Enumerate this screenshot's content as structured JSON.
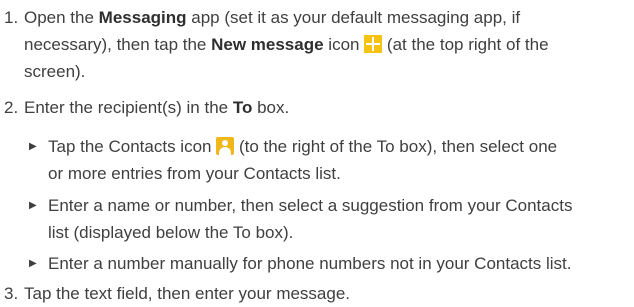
{
  "steps": [
    {
      "number": "1.",
      "a": "Open the ",
      "app_name": "Messaging",
      "b": " app (set it as your default messaging app, if",
      "c": "necessary), then tap the ",
      "icon_label": "New message",
      "d": " icon ",
      "e": " (at the top right of the",
      "f": "screen).",
      "icon": "new-message-plus-icon",
      "icon_color": "#f6c312"
    },
    {
      "number": "2.",
      "a": "Enter the recipient(s) in the ",
      "field": "To",
      "b": " box."
    },
    {
      "number": "3.",
      "text": "Tap the text field, then enter your message."
    }
  ],
  "substeps": [
    {
      "a": "Tap the Contacts icon ",
      "b": " (to the right of the To box), then select one",
      "c": "or more entries from your Contacts list.",
      "icon": "contacts-person-icon",
      "icon_color": "#f0b71a"
    },
    {
      "a": "Enter a name or number, then select a suggestion from your Contacts",
      "b": "list (displayed below the To box)."
    },
    {
      "a": "Enter a number manually for phone numbers not in your Contacts list."
    }
  ]
}
